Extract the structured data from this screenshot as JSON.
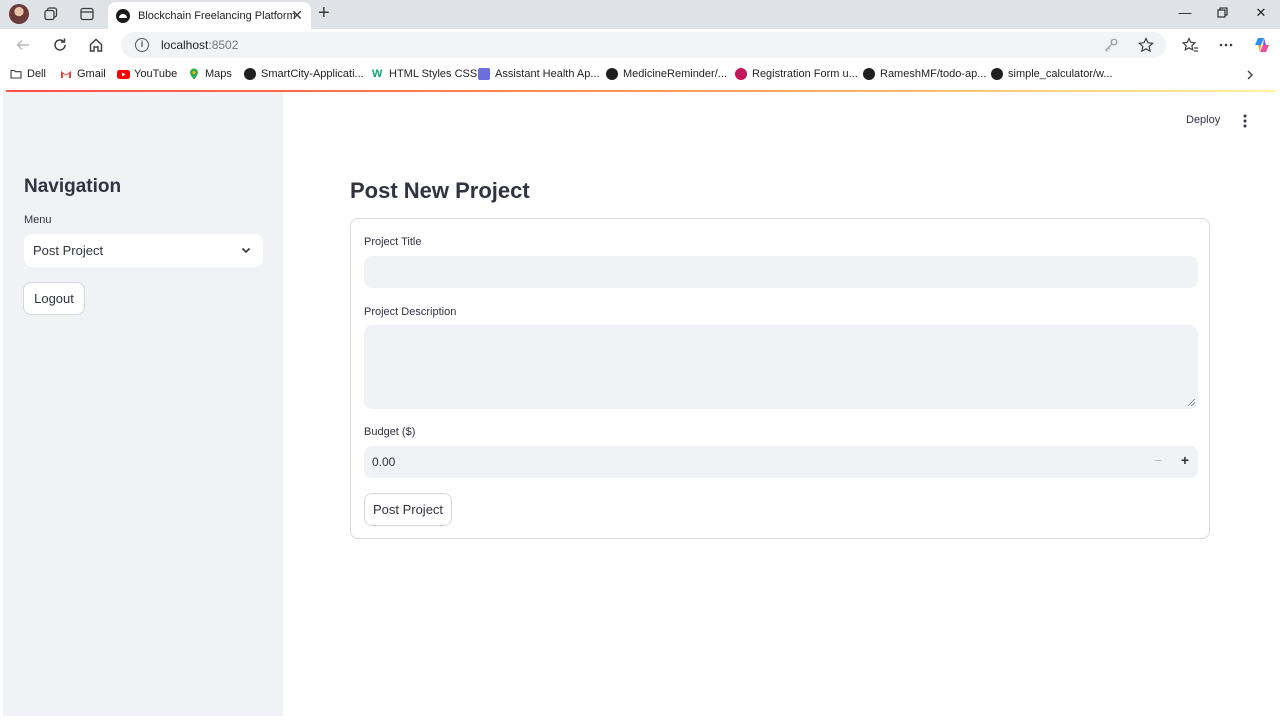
{
  "browser": {
    "tab_title": "Blockchain Freelancing Platform",
    "url_host": "localhost",
    "url_port": ":8502",
    "bookmarks": [
      {
        "label": "Dell",
        "icon": "folder-icon"
      },
      {
        "label": "Gmail",
        "icon": "gmail-icon"
      },
      {
        "label": "YouTube",
        "icon": "youtube-icon"
      },
      {
        "label": "Maps",
        "icon": "maps-icon"
      },
      {
        "label": "SmartCity-Applicati...",
        "icon": "github-icon"
      },
      {
        "label": "HTML Styles CSS",
        "icon": "w3schools-icon"
      },
      {
        "label": "Assistant Health Ap...",
        "icon": "app-icon"
      },
      {
        "label": "MedicineReminder/...",
        "icon": "github-icon"
      },
      {
        "label": "Registration Form u...",
        "icon": "site-icon"
      },
      {
        "label": "RameshMF/todo-ap...",
        "icon": "github-icon"
      },
      {
        "label": "simple_calculator/w...",
        "icon": "github-icon"
      }
    ]
  },
  "sidebar": {
    "title": "Navigation",
    "menu_label": "Menu",
    "menu_selected": "Post Project",
    "logout_label": "Logout"
  },
  "header": {
    "deploy_label": "Deploy"
  },
  "main": {
    "title": "Post New Project",
    "fields": {
      "title_label": "Project Title",
      "title_value": "",
      "description_label": "Project Description",
      "description_value": "",
      "budget_label": "Budget ($)",
      "budget_value": "0.00"
    },
    "submit_label": "Post Project"
  },
  "colors": {
    "accent": "#ff4b4b",
    "sidebar_bg": "#f0f2f6",
    "text": "#31333f"
  }
}
